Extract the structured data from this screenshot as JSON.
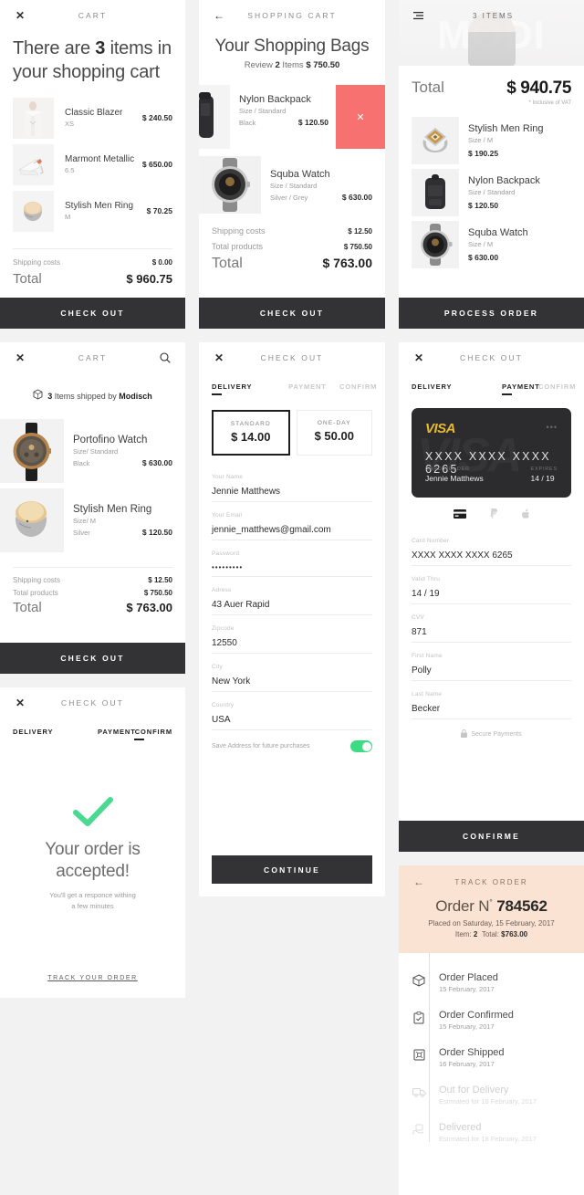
{
  "screens": {
    "cart_overview": {
      "header": {
        "close": "✕",
        "title": "CART"
      },
      "heading_pre": "There are ",
      "heading_num": "3",
      "heading_post": " items in your shopping cart",
      "items": [
        {
          "name": "Classic Blazer",
          "meta": "XS",
          "price": "$ 240.50"
        },
        {
          "name": "Marmont Metallic",
          "meta": "6.5",
          "price": "$ 650.00"
        },
        {
          "name": "Stylish Men Ring",
          "meta": "M",
          "price": "$ 70.25"
        }
      ],
      "shipping_label": "Shipping costs",
      "shipping_value": "$ 0.00",
      "total_label": "Total",
      "total_value": "$ 960.75",
      "cta": "CHECK OUT"
    },
    "shopping_bags": {
      "header": {
        "back": "←",
        "title": "SHOPPING CART"
      },
      "heading": "Your Shopping Bags",
      "review_pre": "Review ",
      "review_count": "2",
      "review_mid": " Items ",
      "review_total": "$ 750.50",
      "items": [
        {
          "name": "Nylon Backpack",
          "size": "Size / Standard",
          "color": "Black",
          "price": "$ 120.50",
          "delete": "✕"
        },
        {
          "name": "Squba Watch",
          "size": "Size / Standard",
          "color": "Silver / Grey",
          "price": "$ 630.00"
        }
      ],
      "shipping_label": "Shipping costs",
      "shipping_value": "$ 12.50",
      "products_label": "Total products",
      "products_value": "$ 750.50",
      "total_label": "Total",
      "total_value": "$ 763.00",
      "cta": "CHECK OUT"
    },
    "order_summary": {
      "header": {
        "menu": "menu-icon",
        "title": "3 ITEMS"
      },
      "total_label": "Total",
      "total_value": "$ 940.75",
      "vat_note": "* Inclusive of VAT",
      "items": [
        {
          "name": "Stylish Men Ring",
          "size": "Size / M",
          "price": "$ 190.25"
        },
        {
          "name": "Nylon Backpack",
          "size": "Size / Standard",
          "price": "$ 120.50"
        },
        {
          "name": "Squba Watch",
          "size": "Size / M",
          "price": "$ 630.00"
        }
      ],
      "cta": "PROCESS ORDER"
    },
    "cart_shipped": {
      "header": {
        "close": "✕",
        "title": "CART",
        "search": "search-icon"
      },
      "shipped_count": "3",
      "shipped_mid": " Items shipped by ",
      "shipped_brand": "Modisch",
      "items": [
        {
          "name": "Portofino Watch",
          "size": "Size/ Standard",
          "color": "Black",
          "price": "$ 630.00"
        },
        {
          "name": "Stylish Men Ring",
          "size": "Size/ M",
          "color": "Silver",
          "price": "$ 120.50"
        }
      ],
      "shipping_label": "Shipping costs",
      "shipping_value": "$ 12.50",
      "products_label": "Total products",
      "products_value": "$ 750.50",
      "total_label": "Total",
      "total_value": "$ 763.00",
      "cta": "CHECK OUT"
    },
    "checkout_delivery": {
      "header": {
        "close": "✕",
        "title": "CHECK OUT"
      },
      "steps": [
        {
          "label": "DELIVERY",
          "active": true
        },
        {
          "label": "PAYMENT",
          "active": false
        },
        {
          "label": "CONFIRM",
          "active": false
        }
      ],
      "delivery_options": [
        {
          "label": "STANDARD",
          "price": "$ 14.00",
          "selected": true
        },
        {
          "label": "ONE-DAY",
          "price": "$ 50.00",
          "selected": false
        }
      ],
      "fields": [
        {
          "label": "Your Name",
          "value": "Jennie Matthews"
        },
        {
          "label": "Your Email",
          "value": "jennie_matthews@gmail.com"
        },
        {
          "label": "Password",
          "value": "•••••••••"
        },
        {
          "label": "Adress",
          "value": "43 Auer Rapid"
        },
        {
          "label": "Zipcode",
          "value": "12550"
        },
        {
          "label": "City",
          "value": "New York"
        },
        {
          "label": "Country",
          "value": "USA"
        }
      ],
      "save_label": "Save Address for future purchases",
      "save_on": true,
      "cta": "CONTINUE"
    },
    "checkout_payment": {
      "header": {
        "close": "✕",
        "title": "CHECK OUT"
      },
      "steps": [
        {
          "label": "DELIVERY",
          "active": false
        },
        {
          "label": "PAYMENT",
          "active": true
        },
        {
          "label": "CONFIRM",
          "active": false
        }
      ],
      "card": {
        "brand": "VISA",
        "menu": "•••",
        "number": "XXXX  XXXX  XXXX  6265",
        "holder_label": "CARD HOLDER",
        "holder": "Jennie Matthews",
        "expires_label": "EXPIRES",
        "expires": "14 / 19"
      },
      "method_icons": [
        "credit-card-icon",
        "paypal-icon",
        "apple-pay-icon"
      ],
      "fields": [
        {
          "label": "Card Number",
          "value": "XXXX XXXX XXXX 6265"
        },
        {
          "label": "Valid Thru",
          "value": "14 / 19"
        },
        {
          "label": "CVV",
          "value": "871"
        },
        {
          "label": "First Name",
          "value": "Polly"
        },
        {
          "label": "Last Name",
          "value": "Becker"
        }
      ],
      "secure_note": "Secure Payments",
      "cta": "CONFIRME"
    },
    "order_accepted": {
      "header": {
        "close": "✕",
        "title": "CHECK OUT"
      },
      "steps": [
        {
          "label": "DELIVERY",
          "active": false
        },
        {
          "label": "PAYMENT",
          "active": false
        },
        {
          "label": "CONFIRM",
          "active": true
        }
      ],
      "title_line1": "Your order is",
      "title_line2": "accepted!",
      "subtitle_line1": "You'll get a responce withing",
      "subtitle_line2": "a few minutes",
      "track_link": "TRACK YOUR ORDER"
    },
    "track_order": {
      "header": {
        "back": "←",
        "title": "TRACK ORDER"
      },
      "order_prefix": "Order N",
      "order_sup": "°",
      "order_number": "784562",
      "placed_on": "Placed on Saturday, 15 February, 2017",
      "item_label": "Item:",
      "item_count": "2",
      "total_label": "Total:",
      "total_value": "$763.00",
      "timeline": [
        {
          "icon": "package-icon",
          "title": "Order Placed",
          "date": "15 February, 2017",
          "done": true
        },
        {
          "icon": "clipboard-check-icon",
          "title": "Order Confirmed",
          "date": "15 February, 2017",
          "done": true
        },
        {
          "icon": "shipping-box-icon",
          "title": "Order Shipped",
          "date": "16 February, 2017",
          "done": true
        },
        {
          "icon": "truck-icon",
          "title": "Out for Delivery",
          "date": "Estimated for 18 February, 2017",
          "done": false
        },
        {
          "icon": "hand-package-icon",
          "title": "Delivered",
          "date": "Estimated for 18 February, 2017",
          "done": false
        }
      ]
    }
  },
  "colors": {
    "cta_dark": "#333335",
    "delete_red": "#f87171",
    "toggle_green": "#3ddc84",
    "check_green": "#4ad991",
    "track_peach": "#fbe3d4",
    "visa_gold": "#e8b930"
  }
}
